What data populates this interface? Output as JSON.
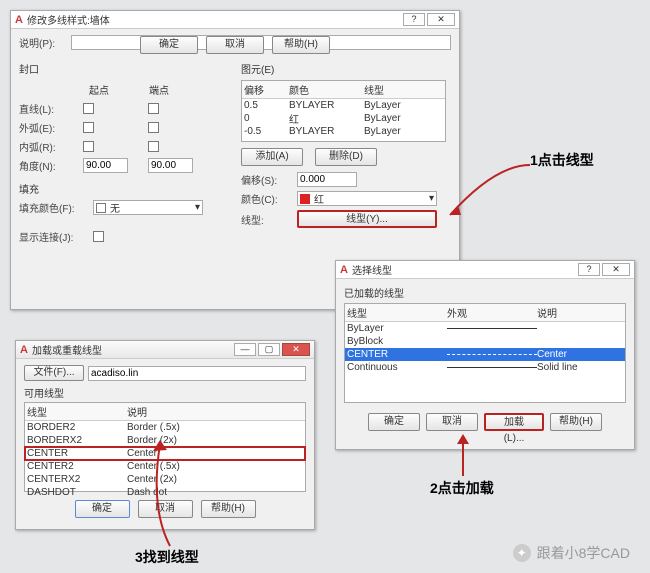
{
  "main": {
    "title": "修改多线样式:墙体",
    "desc_label": "说明(P):",
    "desc_value": "",
    "feng_kou": "封口",
    "qi_dian": "起点",
    "duan_dian": "端点",
    "line_l": "直线(L):",
    "outer_e": "外弧(E):",
    "inner_r": "内弧(R):",
    "angle_n": "角度(N):",
    "angle_v1": "90.00",
    "angle_v2": "90.00",
    "fill": "填充",
    "fill_color_lbl": "填充颜色(F):",
    "fill_none": "无",
    "show_join": "显示连接(J):",
    "tuyuan": "图元(E)",
    "col_offset": "偏移",
    "col_color": "颜色",
    "col_ltype": "线型",
    "elems": [
      {
        "o": "0.5",
        "c": "BYLAYER",
        "t": "ByLayer"
      },
      {
        "o": "0",
        "c": "红",
        "t": "ByLayer"
      },
      {
        "o": "-0.5",
        "c": "BYLAYER",
        "t": "ByLayer"
      }
    ],
    "add_btn": "添加(A)",
    "del_btn": "删除(D)",
    "offset_lbl": "偏移(S):",
    "offset_val": "0.000",
    "color_lbl": "颜色(C):",
    "color_val": "红",
    "ltype_lbl": "线型:",
    "ltype_btn": "线型(Y)...",
    "ok": "确定",
    "cancel": "取消",
    "help": "帮助(H)"
  },
  "sel": {
    "title": "选择线型",
    "loaded": "已加载的线型",
    "col_ltype": "线型",
    "col_appearance": "外观",
    "col_desc": "说明",
    "rows": [
      {
        "n": "ByLayer",
        "d": ""
      },
      {
        "n": "ByBlock",
        "d": ""
      },
      {
        "n": "CENTER",
        "d": "Center"
      },
      {
        "n": "Continuous",
        "d": "Solid line"
      }
    ],
    "ok": "确定",
    "cancel": "取消",
    "load": "加载(L)...",
    "help": "帮助(H)"
  },
  "load": {
    "title": "加载或重载线型",
    "file_lbl": "文件(F)...",
    "file_val": "acadiso.lin",
    "avail": "可用线型",
    "col_ltype": "线型",
    "col_desc": "说明",
    "rows": [
      {
        "n": "BORDER2",
        "d": "Border (.5x)"
      },
      {
        "n": "BORDERX2",
        "d": "Border (2x)"
      },
      {
        "n": "CENTER",
        "d": "Center"
      },
      {
        "n": "CENTER2",
        "d": "Center (.5x)"
      },
      {
        "n": "CENTERX2",
        "d": "Center (2x)"
      },
      {
        "n": "DASHDOT",
        "d": "Dash dot"
      }
    ],
    "ok": "确定",
    "cancel": "取消",
    "help": "帮助(H)"
  },
  "callouts": {
    "c1": "1点击线型",
    "c2": "2点击加载",
    "c3": "3找到线型"
  },
  "brand": "跟着小8学CAD"
}
